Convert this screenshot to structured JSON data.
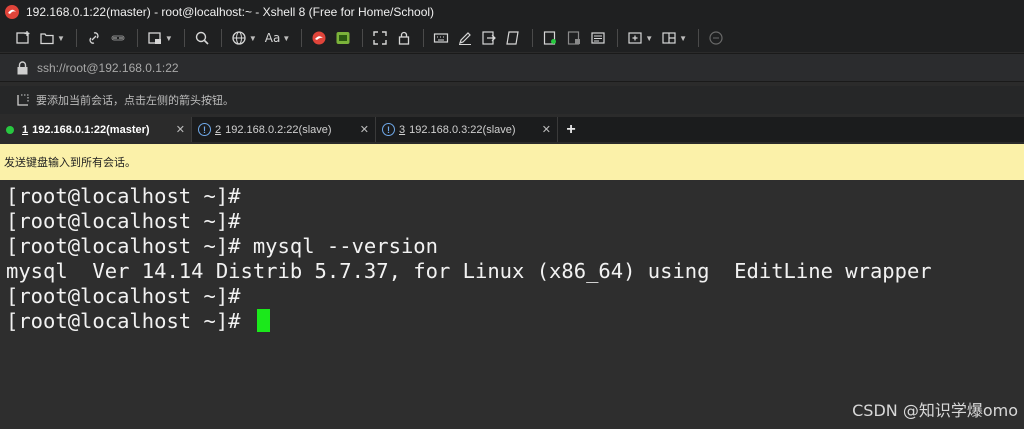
{
  "window": {
    "title": "192.168.0.1:22(master) - root@localhost:~ - Xshell 8 (Free for Home/School)"
  },
  "toolbar": {
    "font_label": "Aa"
  },
  "address": {
    "url": "ssh://root@192.168.0.1:22"
  },
  "hint": {
    "text": "要添加当前会话，点击左侧的箭头按钮。"
  },
  "tabs": [
    {
      "number": "1",
      "label": "192.168.0.1:22(master)",
      "status": "connected"
    },
    {
      "number": "2",
      "label": "192.168.0.2:22(slave)",
      "status": "warning"
    },
    {
      "number": "3",
      "label": "192.168.0.3:22(slave)",
      "status": "warning"
    }
  ],
  "tab_add_label": "+",
  "tab_close_label": "✕",
  "send_bar": {
    "text": "发送键盘输入到所有会话。"
  },
  "terminal": {
    "lines": [
      "[root@localhost ~]#",
      "[root@localhost ~]#",
      "[root@localhost ~]# mysql --version",
      "mysql  Ver 14.14 Distrib 5.7.37, for Linux (x86_64) using  EditLine wrapper",
      "[root@localhost ~]#",
      "[root@localhost ~]# "
    ]
  },
  "watermark": "CSDN @知识学爆omo",
  "colors": {
    "cursor": "#1be81b",
    "send_bar_bg": "#fbf1a9",
    "connected_dot": "#28c840",
    "warning_icon": "#6fa8e8"
  },
  "icons": [
    "xshell-logo-icon",
    "new-session-icon",
    "open-folder-icon",
    "link-icon",
    "unlink-icon",
    "new-tab-icon",
    "search-icon",
    "globe-icon",
    "font-icon",
    "xftp-icon",
    "xmanager-icon",
    "fullscreen-icon",
    "lock-icon",
    "keyboard-icon",
    "pen-icon",
    "transfer-icon",
    "script-icon",
    "log-icon",
    "compose-icon",
    "command-icon",
    "add-folder-icon",
    "layout-icon",
    "chat-icon"
  ]
}
